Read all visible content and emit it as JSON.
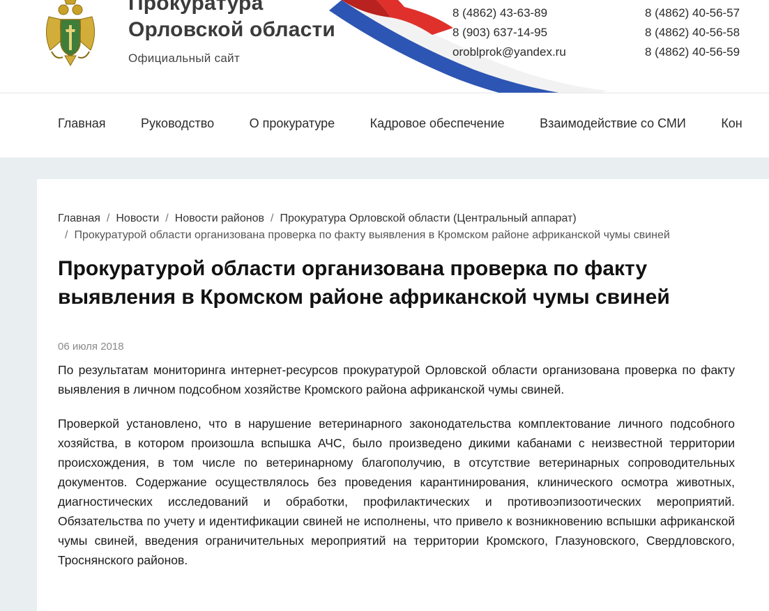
{
  "header": {
    "title_line1": "Прокуратура",
    "title_line2": "Орловской области",
    "subtitle": "Официальный сайт",
    "contacts_left": [
      "8 (4862) 43-63-89",
      "8 (903) 637-14-95",
      "oroblprok@yandex.ru"
    ],
    "contacts_right": [
      "8 (4862) 40-56-57",
      "8 (4862) 40-56-58",
      "8 (4862) 40-56-59"
    ]
  },
  "nav": {
    "items": [
      "Главная",
      "Руководство",
      "О прокуратуре",
      "Кадровое обеспечение",
      "Взаимодействие со СМИ",
      "Кон"
    ]
  },
  "breadcrumb": {
    "items": [
      "Главная",
      "Новости",
      "Новости районов",
      "Прокуратура Орловской области (Центральный аппарат)"
    ],
    "current": "Прокуратурой области организована проверка по факту выявления в Кромском районе африканской чумы свиней"
  },
  "article": {
    "title": "Прокуратурой области организована проверка по факту выявления в Кромском районе африканской чумы свиней",
    "date": "06 июля 2018",
    "paragraphs": [
      "По результатам мониторинга интернет-ресурсов прокуратурой Орловской области организована проверка по факту выявления в личном подсобном хозяйстве Кромского района африканской чумы свиней.",
      "Проверкой установлено, что в нарушение ветеринарного законодательства комплектование личного подсобного хозяйства, в котором произошла вспышка АЧС, было произведено дикими кабанами с неизвестной территории происхождения, в том числе по ветеринарному благополучию, в отсутствие ветеринарных сопроводительных документов. Содержание осуществлялось без проведения карантинирования, клинического осмотра животных, диагностических исследований и обработки, профилактических и противоэпизоотических мероприятий. Обязательства по учету и идентификации свиней не исполнены, что привело к возникновению вспышки африканской чумы свиней, введения ограничительных мероприятий на территории Кромского, Глазуновского, Свердловского, Троснянского районов."
    ]
  },
  "colors": {
    "page_bg": "#e9eef1",
    "card_bg": "#ffffff",
    "ribbon_white": "#ffffff",
    "ribbon_blue": "#2d55b3",
    "ribbon_red": "#e0302b",
    "emblem_gold": "#c9a227",
    "emblem_green": "#3f7d3a"
  },
  "icons": {
    "emblem": "prosecutor-emblem-icon",
    "ribbon": "russian-flag-ribbon"
  }
}
